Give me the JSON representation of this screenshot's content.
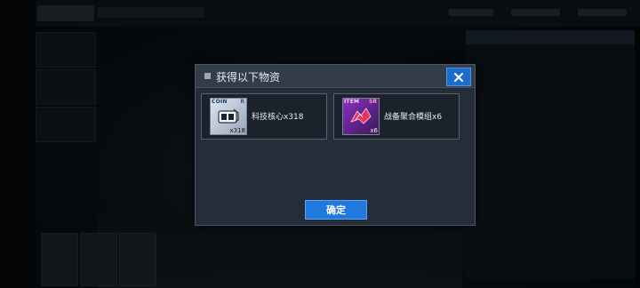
{
  "dialog": {
    "title": "获得以下物资",
    "confirm_label": "确定",
    "close_icon": "close-icon",
    "rewards": [
      {
        "tag": "COIN",
        "rank": "R",
        "count": "x318",
        "label": "科技核心x318",
        "icon": "tech-core-icon"
      },
      {
        "tag": "ITEM",
        "rank": "SR",
        "count": "x6",
        "label": "战备聚合模组x6",
        "icon": "combat-module-icon"
      }
    ]
  },
  "colors": {
    "accent_blue": "#1f79de",
    "dialog_bg": "#252d38",
    "coin_bg": "#c8d2de",
    "item_bg": "#8a2fc2"
  }
}
